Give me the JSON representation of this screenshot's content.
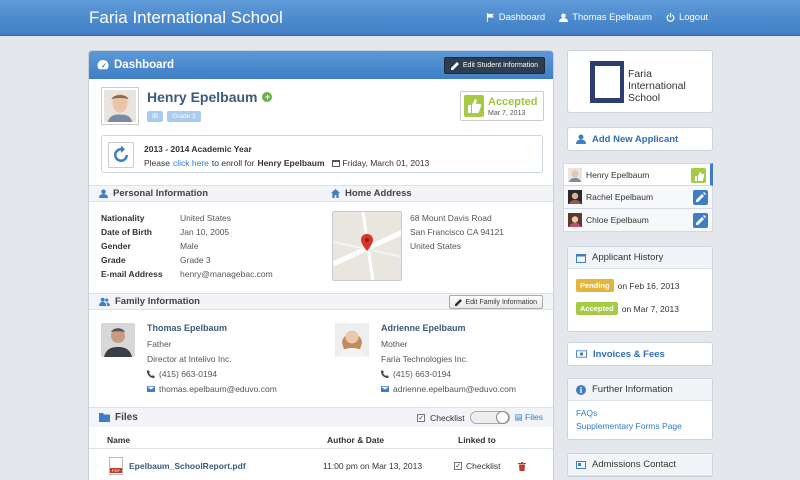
{
  "topbar": {
    "brand": "Faria International School",
    "nav": [
      {
        "label": "Dashboard",
        "icon": "flag-icon"
      },
      {
        "label": "Thomas Epelbaum",
        "icon": "user-icon"
      },
      {
        "label": "Logout",
        "icon": "power-icon"
      }
    ]
  },
  "dashboard": {
    "title": "Dashboard",
    "edit_student_btn": "Edit Student Information"
  },
  "student": {
    "name": "Henry Epelbaum",
    "tags": [
      "IB",
      "Grade 3"
    ],
    "status_label": "Accepted",
    "status_date": "Mar 7, 2013",
    "status_color": "#9fc33f"
  },
  "enroll": {
    "year": "2013 - 2014 Academic Year",
    "prefix": "Please",
    "link": "click here",
    "middle": "to enroll for",
    "student": "Henry Epelbaum",
    "date": "Friday, March 01, 2013"
  },
  "personal": {
    "heading": "Personal Information",
    "fields": [
      {
        "k": "Nationality",
        "v": "United States"
      },
      {
        "k": "Date of Birth",
        "v": "Jan 10, 2005"
      },
      {
        "k": "Gender",
        "v": "Male"
      },
      {
        "k": "Grade",
        "v": "Grade 3"
      },
      {
        "k": "E-mail Address",
        "v": "henry@managebac.com"
      }
    ]
  },
  "address": {
    "heading": "Home Address",
    "lines": [
      "68 Mount Davis Road",
      "San Francisco CA 94121",
      "United States"
    ]
  },
  "family": {
    "heading": "Family Information",
    "edit_btn": "Edit Family Information",
    "members": [
      {
        "name": "Thomas Epelbaum",
        "relation": "Father",
        "job": "Director at Intelivo Inc.",
        "phone": "(415) 663-0194",
        "email": "thomas.epelbaum@eduvo.com"
      },
      {
        "name": "Adrienne Epelbaum",
        "relation": "Mother",
        "job": "Faria Technologies Inc.",
        "phone": "(415) 663-0194",
        "email": "adrienne.epelbaum@eduvo.com"
      }
    ]
  },
  "files": {
    "heading": "Files",
    "checklist": "Checklist",
    "files_link": "Files",
    "columns": [
      "Name",
      "Author & Date",
      "Linked to"
    ],
    "rows": [
      {
        "name": "Epelbaum_SchoolReport.pdf",
        "date": "11:00 pm on Mar 13, 2013",
        "linked": "Checklist"
      }
    ]
  },
  "sidebar": {
    "logo_lines": [
      "Faria",
      "International",
      "School"
    ],
    "add_applicant": "Add New Applicant",
    "applicants": [
      {
        "name": "Henry Epelbaum",
        "status_color": "#a6c946"
      },
      {
        "name": "Rachel Epelbaum",
        "status_color": "#3f7ec6"
      },
      {
        "name": "Chloe Epelbaum",
        "status_color": "#3f7ec6"
      }
    ],
    "history_title": "Applicant History",
    "history": [
      {
        "badge": "Pending",
        "color": "#e5b53a",
        "text": "on Feb 16, 2013"
      },
      {
        "badge": "Accepted",
        "color": "#a6c946",
        "text": "on Mar 7, 2013"
      }
    ],
    "invoices": "Invoices & Fees",
    "further_title": "Further Information",
    "further_links": [
      "FAQs",
      "Supplementary Forms Page"
    ],
    "admissions": "Admissions Contact"
  }
}
